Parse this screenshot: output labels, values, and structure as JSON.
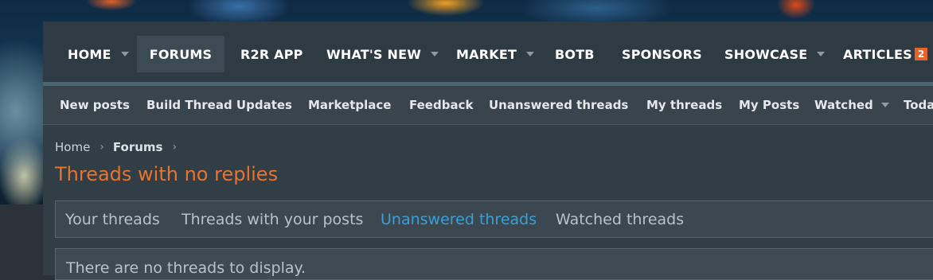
{
  "nav": {
    "items": [
      {
        "label": "HOME",
        "has_menu": true
      },
      {
        "label": "FORUMS",
        "has_menu": false,
        "active": true
      },
      {
        "label": "R2R APP",
        "has_menu": false
      },
      {
        "label": "WHAT'S NEW",
        "has_menu": true
      },
      {
        "label": "MARKET",
        "has_menu": true
      },
      {
        "label": "BOTB",
        "has_menu": false
      },
      {
        "label": "SPONSORS",
        "has_menu": false
      },
      {
        "label": "SHOWCASE",
        "has_menu": true
      },
      {
        "label": "ARTICLES",
        "has_menu": false,
        "badge": "2"
      }
    ]
  },
  "subnav": {
    "items": [
      {
        "label": "New posts"
      },
      {
        "label": "Build Thread Updates"
      },
      {
        "label": "Marketplace"
      },
      {
        "label": "Feedback"
      },
      {
        "label": "Unanswered threads"
      },
      {
        "label": "My threads"
      },
      {
        "label": "My Posts"
      },
      {
        "label": "Watched",
        "has_menu": true
      },
      {
        "label": "Toda"
      }
    ]
  },
  "breadcrumb": {
    "items": [
      "Home",
      "Forums"
    ],
    "separator": "›"
  },
  "page": {
    "title": "Threads with no replies"
  },
  "tabs": {
    "items": [
      {
        "label": "Your threads"
      },
      {
        "label": "Threads with your posts"
      },
      {
        "label": "Unanswered threads",
        "active": true
      },
      {
        "label": "Watched threads"
      }
    ]
  },
  "content": {
    "empty_message": "There are no threads to display."
  },
  "colors": {
    "accent": "#e8732e",
    "active_tab": "#3a9fd8",
    "badge": "#e8632a"
  }
}
